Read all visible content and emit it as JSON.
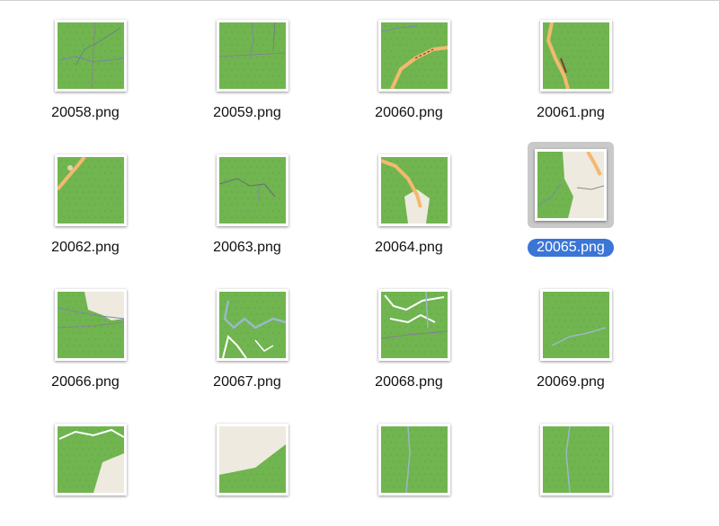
{
  "window": {
    "view": "icon-view"
  },
  "files": [
    {
      "name": "20058.png",
      "selected": false,
      "map": "a"
    },
    {
      "name": "20059.png",
      "selected": false,
      "map": "b"
    },
    {
      "name": "20060.png",
      "selected": false,
      "map": "c"
    },
    {
      "name": "20061.png",
      "selected": false,
      "map": "d"
    },
    {
      "name": "20062.png",
      "selected": false,
      "map": "e"
    },
    {
      "name": "20063.png",
      "selected": false,
      "map": "f"
    },
    {
      "name": "20064.png",
      "selected": false,
      "map": "g"
    },
    {
      "name": "20065.png",
      "selected": true,
      "map": "h"
    },
    {
      "name": "20066.png",
      "selected": false,
      "map": "i"
    },
    {
      "name": "20067.png",
      "selected": false,
      "map": "j"
    },
    {
      "name": "20068.png",
      "selected": false,
      "map": "k"
    },
    {
      "name": "20069.png",
      "selected": false,
      "map": "l"
    },
    {
      "name": "",
      "selected": false,
      "map": "m"
    },
    {
      "name": "",
      "selected": false,
      "map": "n"
    },
    {
      "name": "",
      "selected": false,
      "map": "o"
    },
    {
      "name": "",
      "selected": false,
      "map": "p"
    }
  ],
  "colors": {
    "forest": "#70b54f",
    "road": "#f3b970",
    "land": "#eeeae0",
    "selection": "#3b76d6",
    "selected_icon_bg": "#c9c9c9"
  }
}
